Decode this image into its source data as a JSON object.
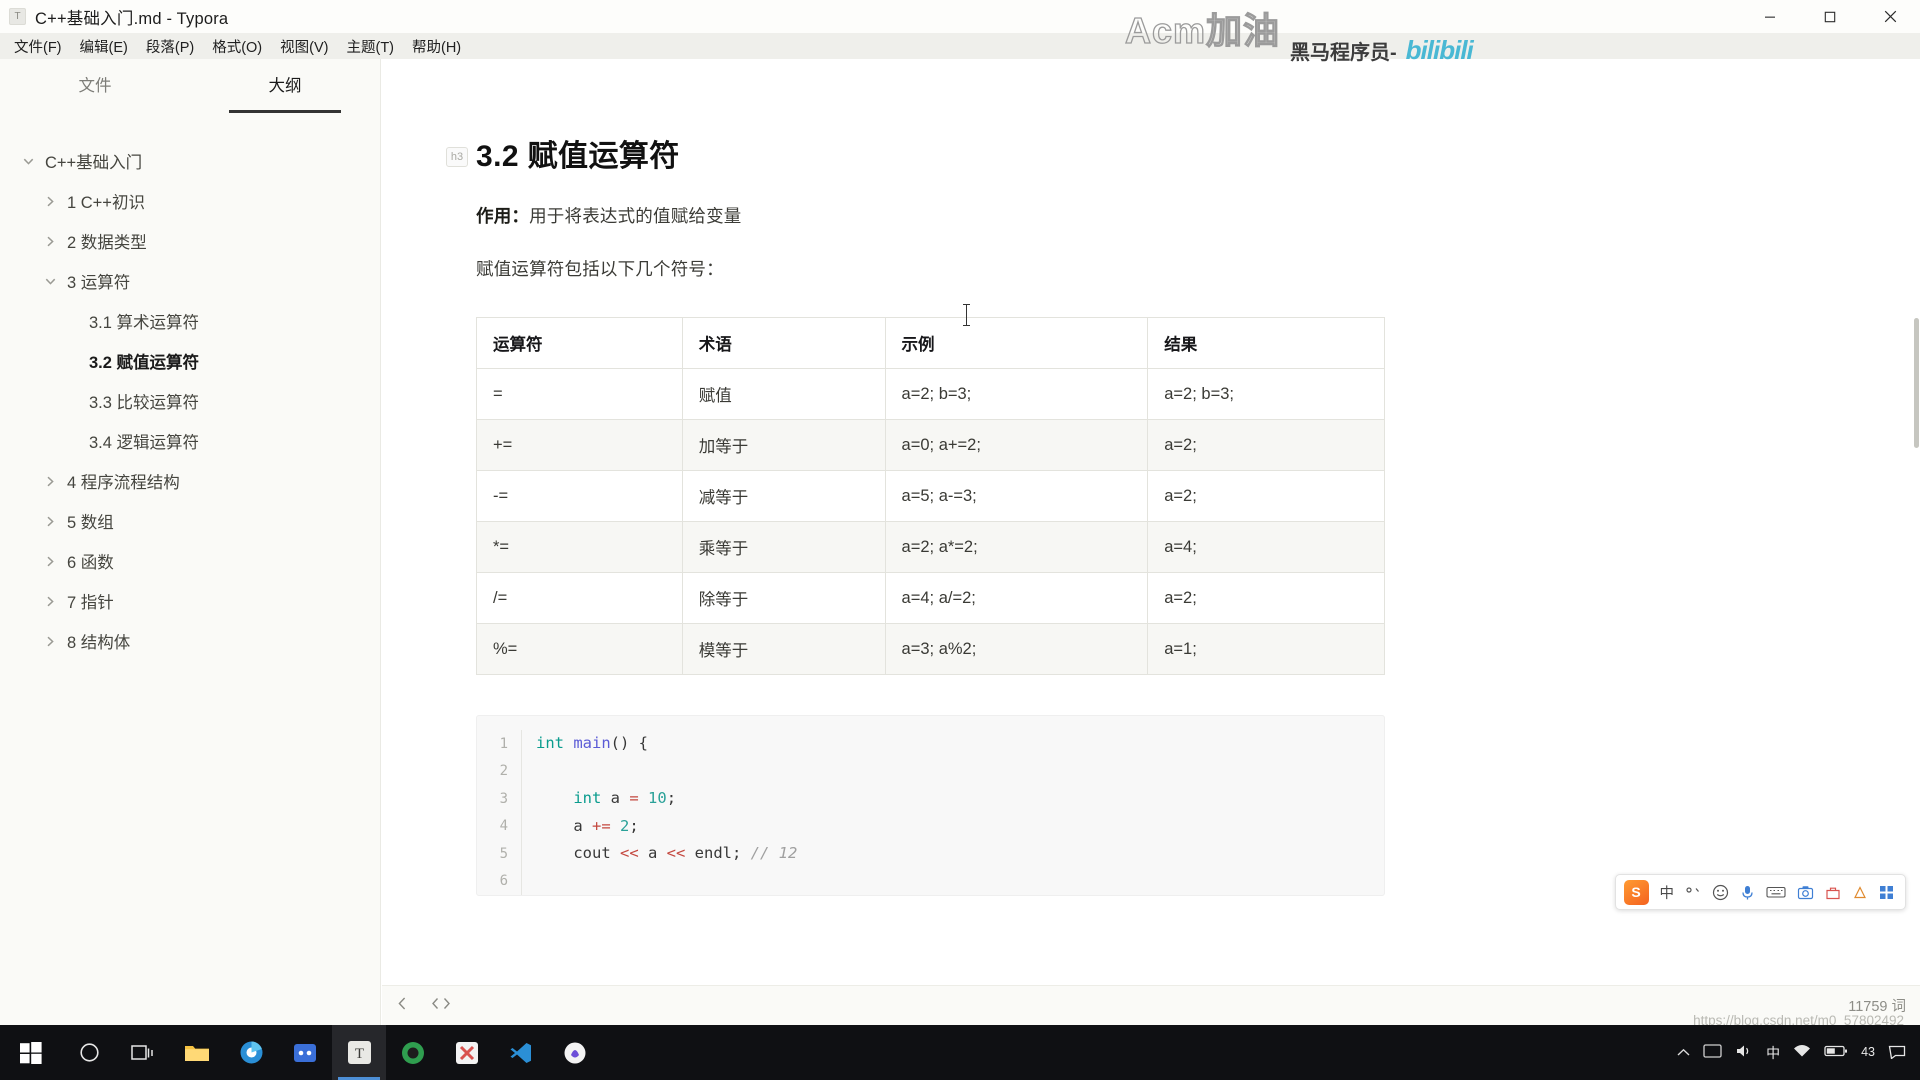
{
  "window": {
    "title": "C++基础入门.md - Typora",
    "app_icon": "T",
    "minimize": "minimize-icon",
    "maximize": "maximize-icon",
    "close": "close-icon"
  },
  "menubar": [
    {
      "label": "文件(F)"
    },
    {
      "label": "编辑(E)"
    },
    {
      "label": "段落(P)"
    },
    {
      "label": "格式(O)"
    },
    {
      "label": "视图(V)"
    },
    {
      "label": "主题(T)"
    },
    {
      "label": "帮助(H)"
    }
  ],
  "sidebar": {
    "tabs": [
      {
        "label": "文件",
        "active": false
      },
      {
        "label": "大纲",
        "active": true
      }
    ],
    "outline": [
      {
        "label": "C++基础入门",
        "indent": 0,
        "chevron": "open",
        "bold": false
      },
      {
        "label": "1 C++初识",
        "indent": 1,
        "chevron": "closed",
        "bold": false
      },
      {
        "label": "2 数据类型",
        "indent": 1,
        "chevron": "closed",
        "bold": false
      },
      {
        "label": "3 运算符",
        "indent": 1,
        "chevron": "open",
        "bold": false
      },
      {
        "label": "3.1 算术运算符",
        "indent": 2,
        "chevron": "none",
        "bold": false
      },
      {
        "label": "3.2 赋值运算符",
        "indent": 2,
        "chevron": "none",
        "bold": true
      },
      {
        "label": "3.3 比较运算符",
        "indent": 2,
        "chevron": "none",
        "bold": false
      },
      {
        "label": "3.4 逻辑运算符",
        "indent": 2,
        "chevron": "none",
        "bold": false
      },
      {
        "label": "4 程序流程结构",
        "indent": 1,
        "chevron": "closed",
        "bold": false
      },
      {
        "label": "5 数组",
        "indent": 1,
        "chevron": "closed",
        "bold": false
      },
      {
        "label": "6 函数",
        "indent": 1,
        "chevron": "closed",
        "bold": false
      },
      {
        "label": "7 指针",
        "indent": 1,
        "chevron": "closed",
        "bold": false
      },
      {
        "label": "8 结构体",
        "indent": 1,
        "chevron": "closed",
        "bold": false
      }
    ]
  },
  "document": {
    "heading_badge": "h3",
    "heading": "3.2 赋值运算符",
    "para1_label": "作用：",
    "para1_rest": "用于将表达式的值赋给变量",
    "para2": "赋值运算符包括以下几个符号：",
    "table": {
      "headers": [
        "运算符",
        "术语",
        "示例",
        "结果"
      ],
      "rows": [
        [
          "=",
          "赋值",
          "a=2; b=3;",
          "a=2; b=3;"
        ],
        [
          "+=",
          "加等于",
          "a=0; a+=2;",
          "a=2;"
        ],
        [
          "-=",
          "减等于",
          "a=5; a-=3;",
          "a=2;"
        ],
        [
          "*=",
          "乘等于",
          "a=2; a*=2;",
          "a=4;"
        ],
        [
          "/=",
          "除等于",
          "a=4; a/=2;",
          "a=2;"
        ],
        [
          "%=",
          "模等于",
          "a=3; a%2;",
          "a=1;"
        ]
      ]
    },
    "code": {
      "lines": [
        {
          "n": "1",
          "tokens": [
            {
              "t": "int",
              "c": "k"
            },
            {
              "t": " ",
              "c": ""
            },
            {
              "t": "main",
              "c": "fn"
            },
            {
              "t": "() {",
              "c": ""
            }
          ]
        },
        {
          "n": "2",
          "tokens": []
        },
        {
          "n": "3",
          "tokens": [
            {
              "t": "    ",
              "c": ""
            },
            {
              "t": "int",
              "c": "k"
            },
            {
              "t": " a ",
              "c": ""
            },
            {
              "t": "=",
              "c": "op"
            },
            {
              "t": " ",
              "c": ""
            },
            {
              "t": "10",
              "c": "num"
            },
            {
              "t": ";",
              "c": ""
            }
          ]
        },
        {
          "n": "4",
          "tokens": [
            {
              "t": "    a ",
              "c": ""
            },
            {
              "t": "+=",
              "c": "op"
            },
            {
              "t": " ",
              "c": ""
            },
            {
              "t": "2",
              "c": "num"
            },
            {
              "t": ";",
              "c": ""
            }
          ]
        },
        {
          "n": "5",
          "tokens": [
            {
              "t": "    cout ",
              "c": ""
            },
            {
              "t": "<<",
              "c": "op"
            },
            {
              "t": " a ",
              "c": ""
            },
            {
              "t": "<<",
              "c": "op"
            },
            {
              "t": " endl; ",
              "c": ""
            },
            {
              "t": "// 12",
              "c": "cm"
            }
          ]
        },
        {
          "n": "6",
          "tokens": []
        }
      ]
    }
  },
  "statusbar": {
    "prev_icon": "chevron-left-icon",
    "source_icon": "source-code-icon",
    "wordcount": "11759 词"
  },
  "ime": {
    "logo": "S",
    "lang": "中",
    "punct_icon": "punctuation-icon",
    "emoji_icon": "emoji-icon",
    "mic_icon": "microphone-icon",
    "keyboard_icon": "keyboard-icon",
    "screenshot_icon": "screenshot-icon",
    "toolbox_icon": "toolbox-icon",
    "skin_icon": "skin-icon",
    "menu_icon": "menu-grid-icon"
  },
  "taskbar": {
    "start_icon": "windows-start-icon",
    "items": [
      {
        "name": "cortana-search-icon",
        "active": false
      },
      {
        "name": "task-view-icon",
        "active": false
      },
      {
        "name": "file-explorer-icon",
        "active": false
      },
      {
        "name": "browser-icon",
        "active": false
      },
      {
        "name": "app-blue-icon",
        "active": false
      },
      {
        "name": "typora-icon",
        "active": true
      },
      {
        "name": "green-app-icon",
        "active": false
      },
      {
        "name": "x-app-icon",
        "active": false
      },
      {
        "name": "vscode-icon",
        "active": false
      },
      {
        "name": "snipaste-icon",
        "active": false
      }
    ],
    "tray": {
      "chevron": "show-hidden-icons",
      "ime_mode": "中",
      "sound_icon": "speaker-icon",
      "network_icon": "network-icon",
      "battery": "43"
    }
  },
  "watermarks": {
    "acm": "Acm加油",
    "heima": "黑马程序员-",
    "bilibili": "bilibili",
    "url": "https://blog.csdn.net/m0_57802492"
  },
  "colors": {
    "accent": "#4d8fd6",
    "sidebar_bg": "#fafaf7",
    "taskbar_bg": "#0f1013",
    "code_bg": "#f8f8f8"
  }
}
